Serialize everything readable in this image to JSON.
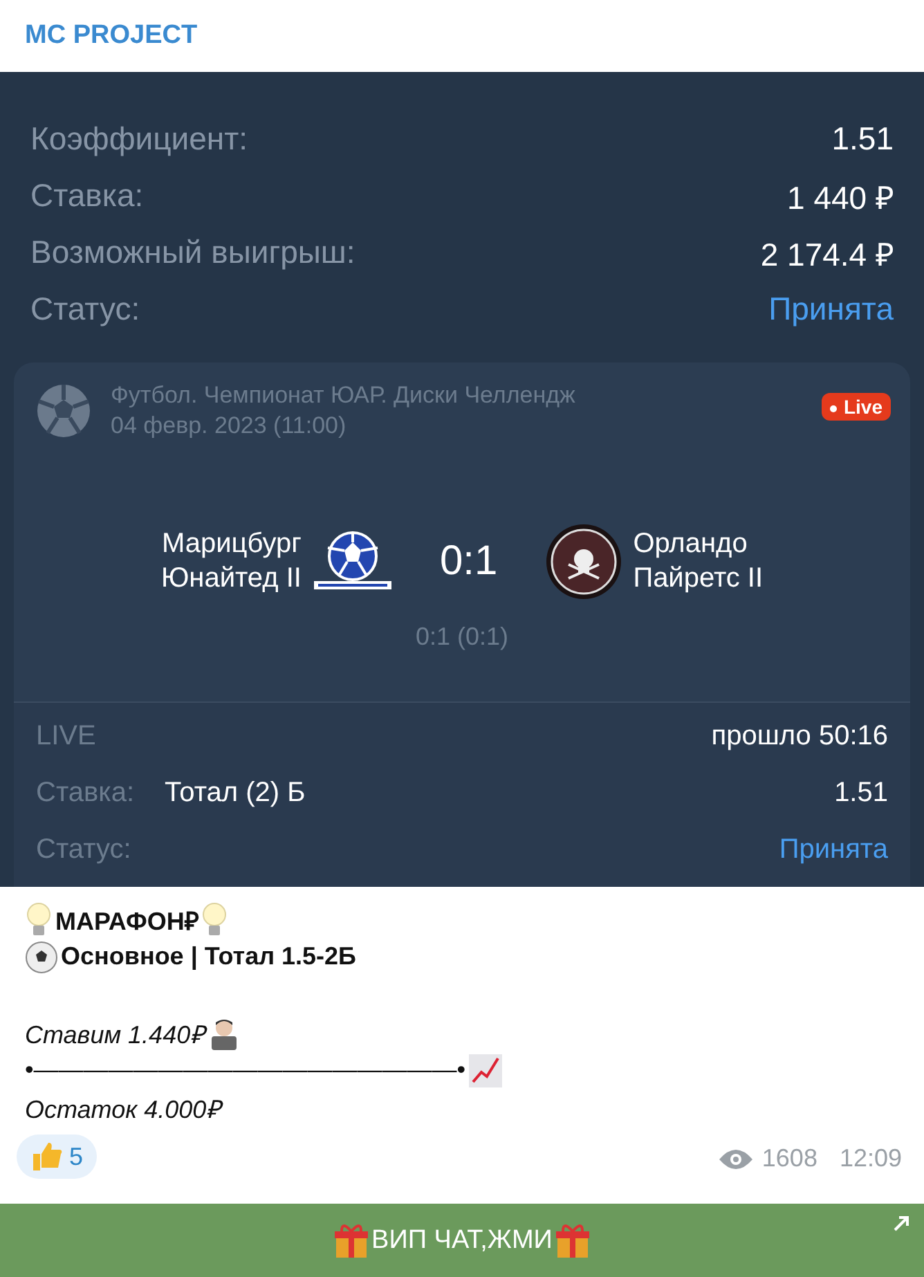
{
  "channel": {
    "title": "MC PROJECT"
  },
  "summary": [
    {
      "label": "Коэффициент:",
      "value": "1.51",
      "kind": "plain"
    },
    {
      "label": "Ставка:",
      "value": "1 440 ₽",
      "kind": "plain"
    },
    {
      "label": "Возможный выигрыш:",
      "value": "2 174.4 ₽",
      "kind": "plain"
    },
    {
      "label": "Статус:",
      "value": "Принята",
      "kind": "status"
    }
  ],
  "match": {
    "league": "Футбол. Чемпионат ЮАР. Диски Челлендж",
    "date": "04 февр. 2023 (11:00)",
    "badge": "Live",
    "live": true,
    "home": {
      "line1": "Марицбург",
      "line2": "Юнайтед II"
    },
    "score": "0:1",
    "away": {
      "line1": "Орландо",
      "line2": "Пайретс II"
    },
    "halftime": "0:1 (0:1)",
    "phase": "LIVE",
    "elapsed": "прошло 50:16",
    "bet_label": "Ставка:",
    "bet": "Тотал (2) Б",
    "bet_odds": "1.51",
    "status_label": "Статус:",
    "status": "Принята"
  },
  "message": {
    "title": "МАРАФОН₽",
    "subtitle": "Основное | Тотал 1.5-2Б",
    "stake": "Ставим 1.440₽",
    "separator": "•—————————————————•",
    "rest": "Остаток 4.000₽"
  },
  "reaction": {
    "count": "5"
  },
  "meta": {
    "views": "1608",
    "time": "12:09"
  },
  "button": {
    "label": "ВИП ЧАТ,ЖМИ"
  }
}
